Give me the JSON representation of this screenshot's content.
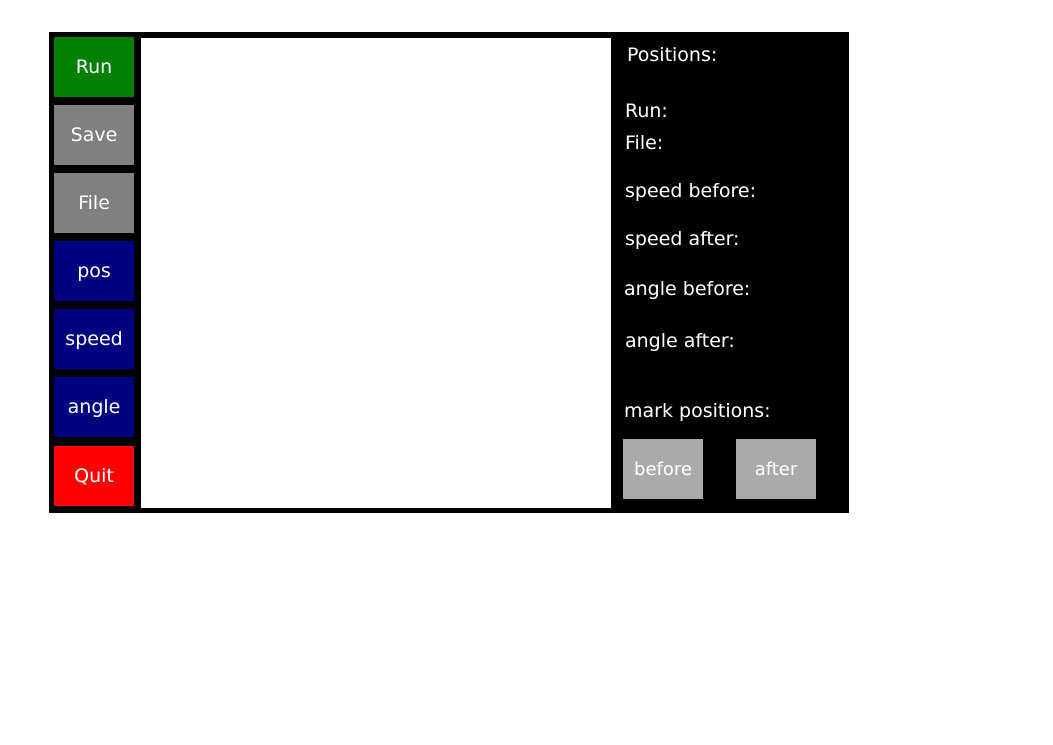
{
  "sidebar": {
    "run": {
      "label": "Run",
      "color": "#008000"
    },
    "save": {
      "label": "Save",
      "color": "#808080"
    },
    "file": {
      "label": "File",
      "color": "#808080"
    },
    "pos": {
      "label": "pos",
      "color": "#000080"
    },
    "speed": {
      "label": "speed",
      "color": "#000080"
    },
    "angle": {
      "label": "angle",
      "color": "#000080"
    },
    "quit": {
      "label": "Quit",
      "color": "#ff0000"
    }
  },
  "info_panel": {
    "positions_label": "Positions:",
    "run_label": "Run:",
    "file_label": "File:",
    "speed_before_label": "speed before:",
    "speed_after_label": "speed after:",
    "angle_before_label": "angle before:",
    "angle_after_label": "angle after:",
    "mark_positions_label": "mark positions:",
    "before_button": "before",
    "after_button": "after"
  },
  "colors": {
    "window_background": "#000000",
    "canvas_background": "#ffffff",
    "text": "#ffffff",
    "mark_button": "#aaaaaa"
  }
}
